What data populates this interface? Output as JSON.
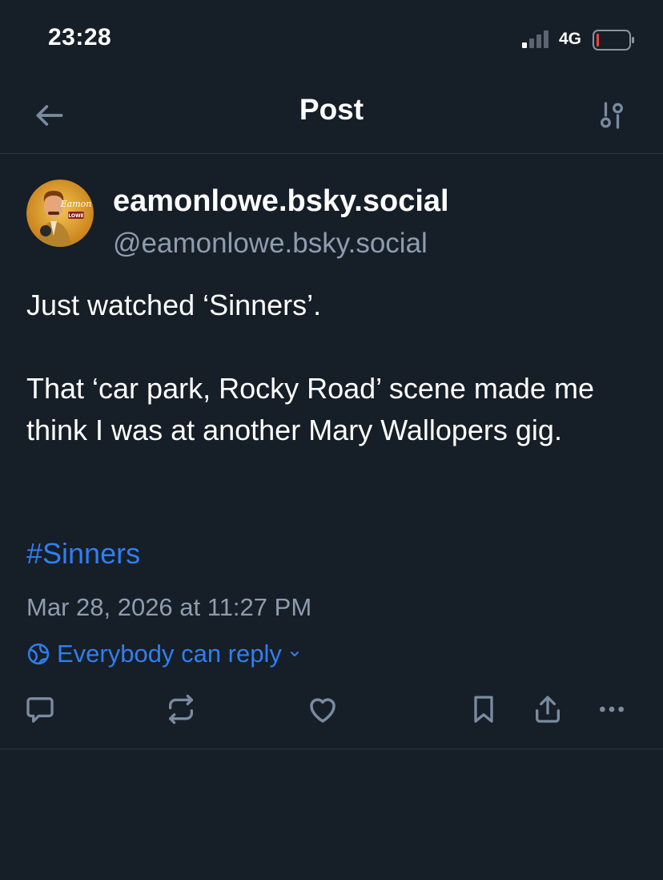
{
  "status_bar": {
    "time": "23:28",
    "network": "4G",
    "battery_color": "#e8453c"
  },
  "nav": {
    "title": "Post",
    "back_icon": "arrow-left-icon",
    "settings_icon": "sliders-icon"
  },
  "post": {
    "author": {
      "display_name": "eamonlowe.bsky.social",
      "handle": "@eamonlowe.bsky.social",
      "avatar_text_1": "Eamon",
      "avatar_text_2": "LOWE"
    },
    "text_lines": [
      "Just watched ‘Sinners’.",
      "That ‘car park, Rocky Road’ scene made me think I was at another Mary Wallopers gig."
    ],
    "hashtag": "#Sinners",
    "timestamp": "Mar 28, 2026 at 11:27 PM",
    "reply_setting": "Everybody can reply"
  },
  "actions": [
    {
      "name": "reply",
      "icon": "comment-icon"
    },
    {
      "name": "repost",
      "icon": "repost-icon"
    },
    {
      "name": "like",
      "icon": "heart-icon"
    },
    {
      "name": "bookmark",
      "icon": "bookmark-icon"
    },
    {
      "name": "share",
      "icon": "share-icon"
    },
    {
      "name": "more",
      "icon": "more-icon"
    }
  ],
  "colors": {
    "background": "#161e27",
    "text": "#ffffff",
    "muted": "#8d9db0",
    "accent": "#2f7fef",
    "icon": "#7a8ba0"
  }
}
